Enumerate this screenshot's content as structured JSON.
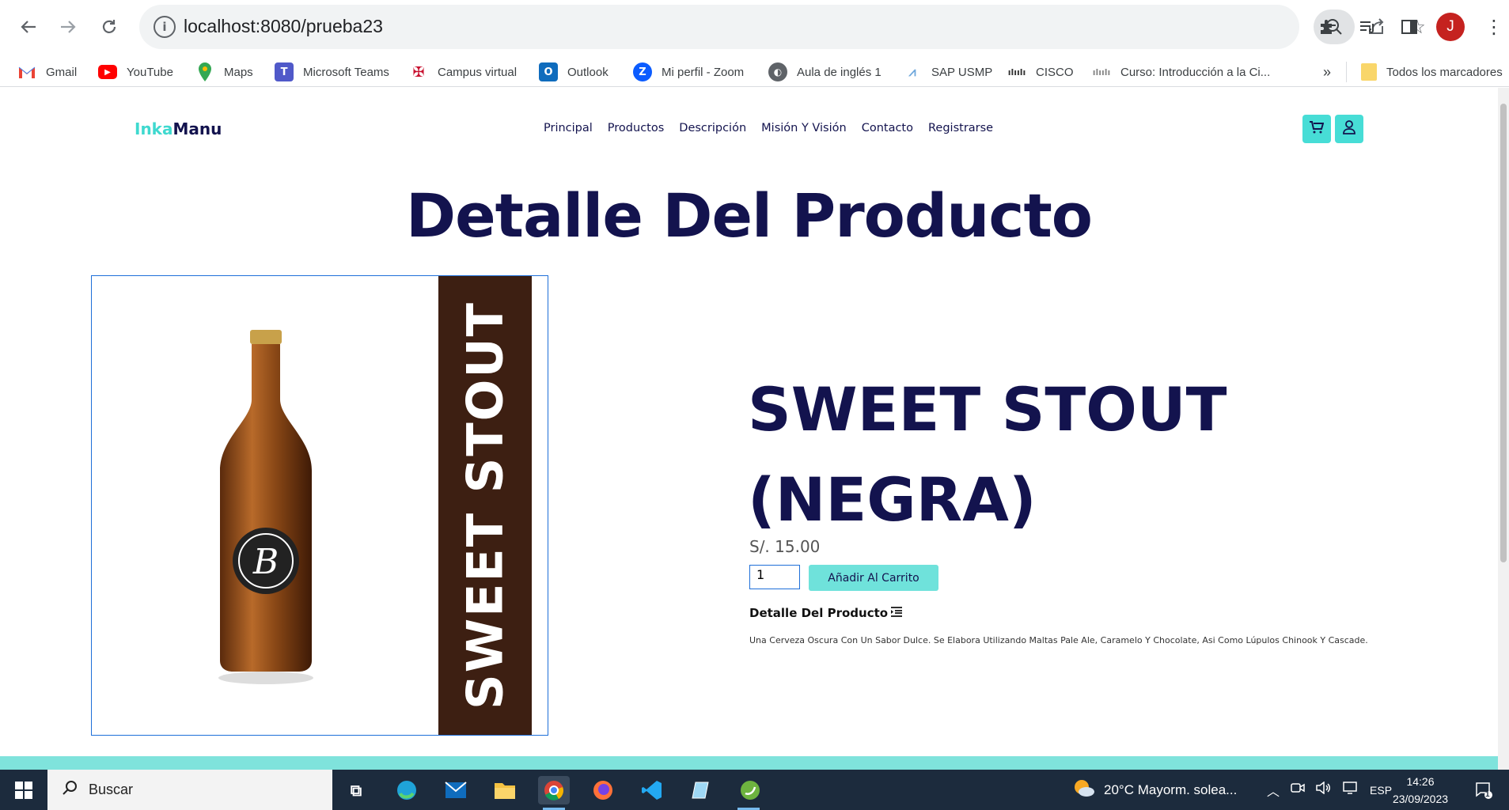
{
  "browser": {
    "url": "localhost:8080/prueba23",
    "bookmarks": [
      {
        "label": "Gmail",
        "icon": "gmail-icon"
      },
      {
        "label": "YouTube",
        "icon": "youtube-icon"
      },
      {
        "label": "Maps",
        "icon": "maps-icon"
      },
      {
        "label": "Microsoft Teams",
        "icon": "teams-icon"
      },
      {
        "label": "Campus virtual",
        "icon": "campus-icon"
      },
      {
        "label": "Outlook",
        "icon": "outlook-icon"
      },
      {
        "label": "Mi perfil - Zoom",
        "icon": "zoom-icon"
      },
      {
        "label": "Aula de inglés 1",
        "icon": "aula-icon"
      },
      {
        "label": "SAP USMP",
        "icon": "sap-icon"
      },
      {
        "label": "CISCO",
        "icon": "cisco-icon"
      },
      {
        "label": "Curso: Introducción a la Ci...",
        "icon": "cisco-icon"
      }
    ],
    "more_bookmarks": "»",
    "all_bookmarks": "Todos los marcadores",
    "avatar_letter": "J"
  },
  "site": {
    "logo_a": "Inka",
    "logo_b": "Manu",
    "nav": [
      "Principal",
      "Productos",
      "Descripción",
      "Misión Y Visión",
      "Contacto",
      "Registrarse"
    ],
    "heading": "Detalle Del Producto"
  },
  "product": {
    "image_label": "SWEET STOUT",
    "title": "SWEET STOUT (NEGRA)",
    "price": "S/. 15.00",
    "quantity": "1",
    "add_button": "Añadir Al Carrito",
    "detail_heading": "Detalle Del Producto",
    "description": "Una Cerveza Oscura Con Un Sabor Dulce. Se Elabora Utilizando Maltas Pale Ale, Caramelo Y Chocolate, Asi Como Lúpulos Chinook Y Cascade."
  },
  "taskbar": {
    "search_label": "Buscar",
    "weather": "20°C  Mayorm. solea...",
    "language": "ESP",
    "time": "14:26",
    "date": "23/09/2023",
    "notification_count": "1"
  },
  "colors": {
    "accent": "#47ddd6",
    "navy": "#13134e",
    "stripe": "#3d1f12"
  }
}
